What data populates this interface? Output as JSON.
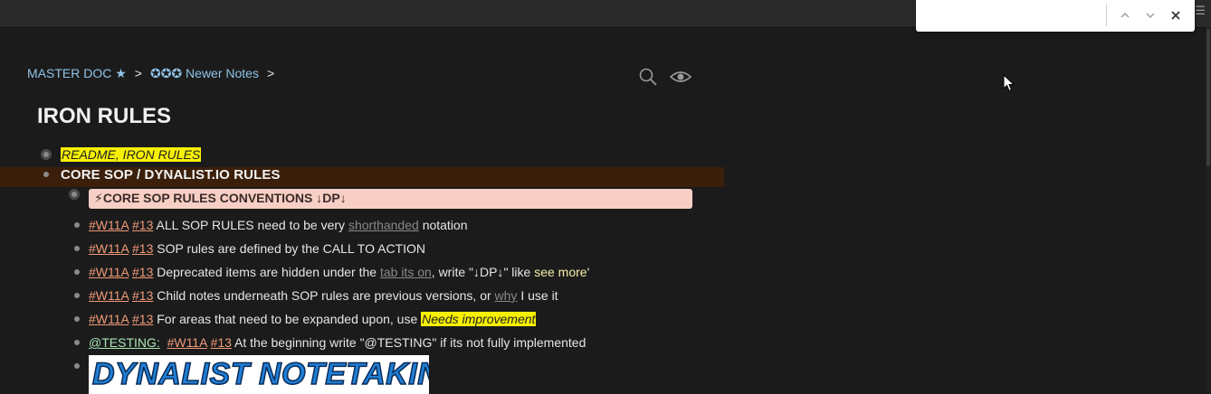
{
  "find": {
    "value": "",
    "placeholder": ""
  },
  "breadcrumb": {
    "root": "MASTER DOC ★",
    "parent": "✪✪✪ Newer Notes",
    "sep": ">"
  },
  "page_title": "IRON RULES",
  "items": {
    "readme": "README, IRON RULES",
    "core": "CORE SOP / DYNALIST.IO RULES",
    "conventions": "⚡CORE SOP RULES CONVENTIONS ↓DP↓",
    "tag_a": "#W11A",
    "tag_b": "#13",
    "r1_a": "ALL SOP RULES need to be very",
    "r1_link": "shorthanded",
    "r1_b": "notation",
    "r2": "SOP rules are defined by the CALL TO ACTION",
    "r3_a": "Deprecated items are hidden under the",
    "r3_link": "tab its on",
    "r3_b": ", write \"↓DP↓\" like",
    "r3_more": "see more",
    "r3_c": "'",
    "r4_a": "Child notes underneath SOP rules are previous versions, or",
    "r4_link": "why",
    "r4_b": "I use it",
    "r5_a": "For areas that need to be expanded upon, use",
    "r5_hl": "Needs improvement",
    "r6_mention": "@TESTING:",
    "r6_a": "At the beginning write \"@TESTING\" if its not fully implemented",
    "banner": "DYNALIST NOTETAKING"
  },
  "colors": {
    "tag": "#f09a78",
    "mention": "#a9e3b5",
    "highlight": "#f7f000",
    "pink": "#f7cfc4",
    "active_row": "#3b1f0a",
    "breadcrumb": "#8fc3e8"
  },
  "icons": [
    "menu-icon",
    "chevron-up-icon",
    "chevron-down-icon",
    "close-icon",
    "search-icon",
    "eye-icon",
    "cursor-icon"
  ]
}
